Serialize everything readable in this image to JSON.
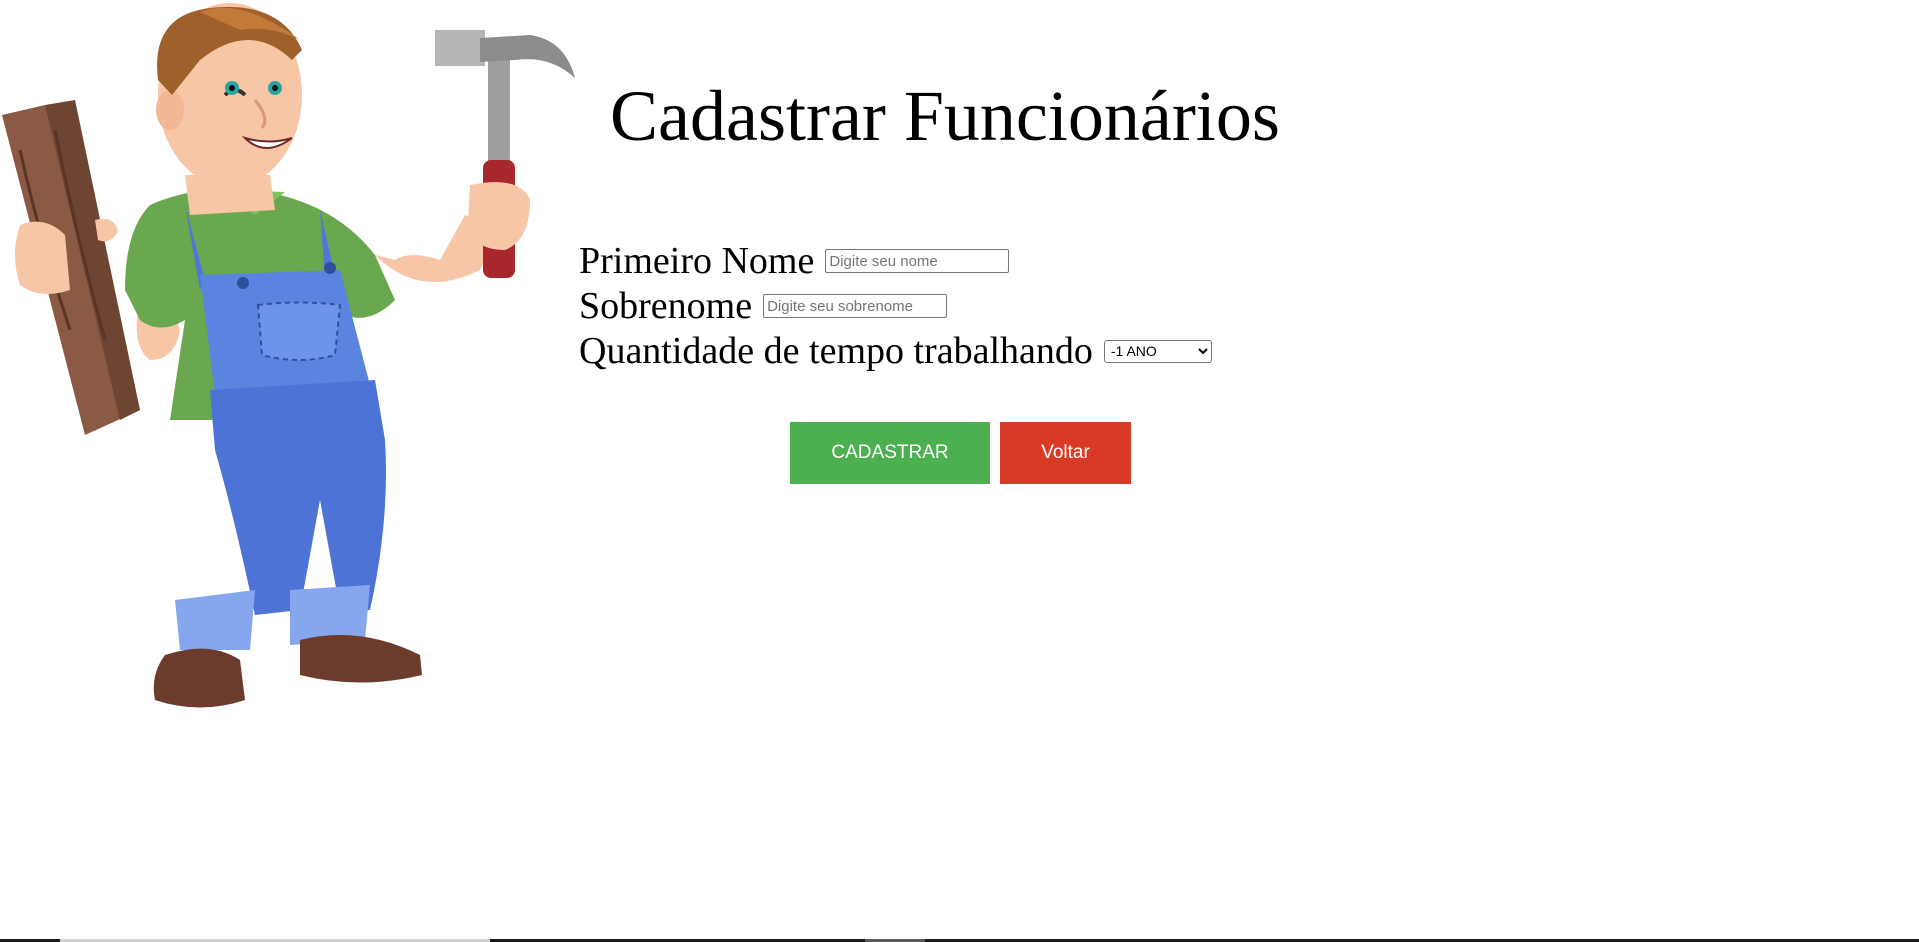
{
  "page": {
    "title": "Cadastrar Funcionários"
  },
  "illustration": {
    "subject": "worker-with-hammer-and-plank"
  },
  "form": {
    "first_name": {
      "label": "Primeiro Nome",
      "value": "",
      "placeholder": "Digite seu nome"
    },
    "last_name": {
      "label": "Sobrenome",
      "value": "",
      "placeholder": "Digite seu sobrenome"
    },
    "work_time": {
      "label": "Quantidade de tempo trabalhando",
      "selected": "-1 ANO"
    }
  },
  "buttons": {
    "register": {
      "label": "CADASTRAR",
      "color": "#4CAF50"
    },
    "back": {
      "label": "Voltar",
      "color": "#D93A26"
    }
  }
}
